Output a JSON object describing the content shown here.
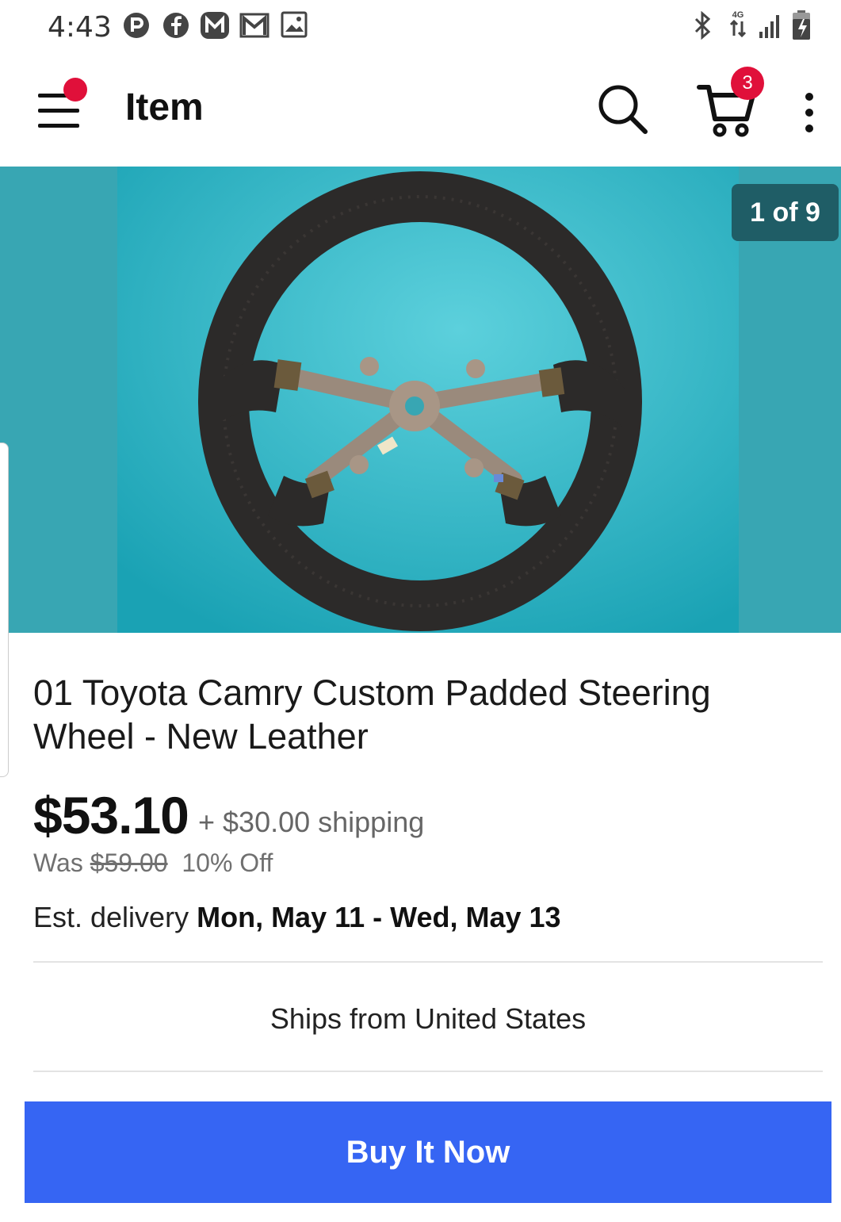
{
  "status_bar": {
    "time": "4:43",
    "left_icons": [
      "p-app-icon",
      "facebook-icon",
      "gmail-m-icon",
      "gmail-icon",
      "gallery-image-icon"
    ],
    "right_icons": [
      "bluetooth-icon",
      "4g-lte-icon",
      "signal-icon",
      "battery-icon"
    ],
    "network_label": "4G"
  },
  "app_bar": {
    "title": "Item",
    "cart_count": "3",
    "icons": [
      "menu-icon",
      "search-icon",
      "cart-icon",
      "more-vertical-icon"
    ]
  },
  "gallery": {
    "counter": "1 of 9",
    "image_subject": "steering-wheel-photo"
  },
  "item": {
    "title": "01 Toyota Camry Custom Padded Steering Wheel - New Leather",
    "price": "$53.10",
    "shipping": "+ $30.00 shipping",
    "was_label": "Was",
    "was_price": "$59.00",
    "discount": "10% Off",
    "delivery_label": "Est. delivery",
    "delivery_dates": "Mon, May 11 - Wed, May 13",
    "ships_from": "Ships from United States"
  },
  "actions": {
    "buy_now": "Buy It Now"
  },
  "colors": {
    "accent": "#3665f3",
    "badge": "#e0103a",
    "photo_background": "#38a6b3"
  }
}
